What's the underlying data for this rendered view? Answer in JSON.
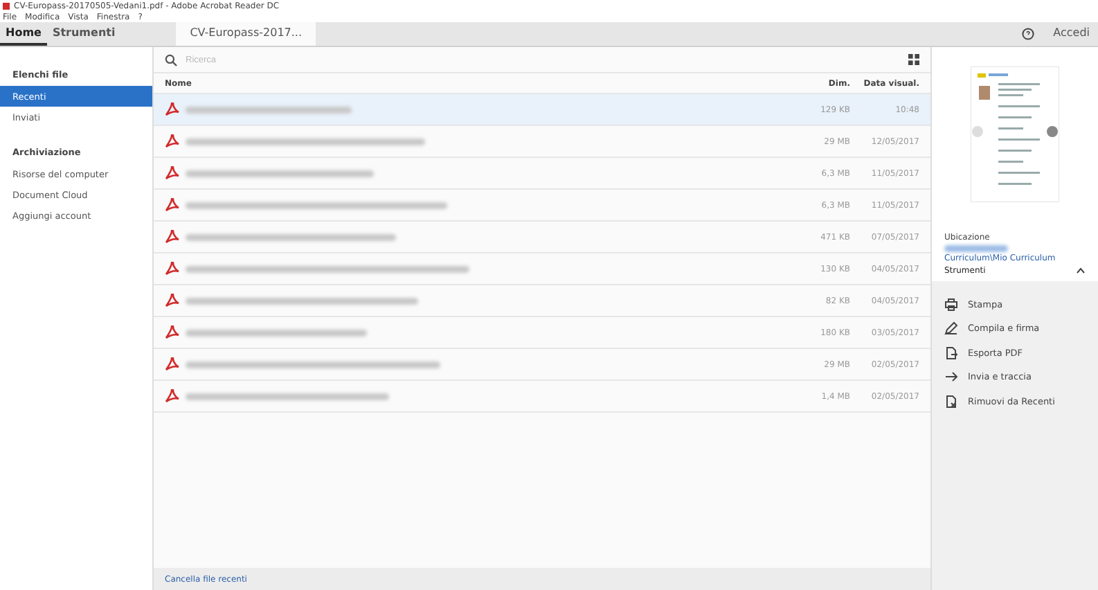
{
  "window": {
    "title": "CV-Europass-20170505-Vedani1.pdf - Adobe Acrobat Reader DC"
  },
  "menu": [
    "File",
    "Modifica",
    "Vista",
    "Finestra",
    "?"
  ],
  "tabs": [
    {
      "label": "Home",
      "selected": true
    },
    {
      "label": "Strumenti",
      "selected": false
    },
    {
      "label": "CV-Europass-2017...",
      "selected": false,
      "kind": "document"
    }
  ],
  "sign_in": "Accedi",
  "sidebar": {
    "sections": [
      {
        "title": "Elenchi file",
        "items": [
          {
            "label": "Recenti",
            "selected": true
          },
          {
            "label": "Inviati",
            "selected": false
          }
        ]
      },
      {
        "title": "Archiviazione",
        "items": [
          {
            "label": "Risorse del computer",
            "selected": false
          },
          {
            "label": "Document Cloud",
            "selected": false
          },
          {
            "label": "Aggiungi account",
            "selected": false
          }
        ]
      }
    ]
  },
  "search": {
    "placeholder": "Ricerca"
  },
  "table": {
    "columns": [
      "Nome",
      "Dim.",
      "Data visual."
    ],
    "rows": [
      {
        "size": "129 KB",
        "date": "10:48",
        "selected": true
      },
      {
        "size": "29 MB",
        "date": "12/05/2017",
        "selected": false
      },
      {
        "size": "6,3 MB",
        "date": "11/05/2017",
        "selected": false
      },
      {
        "size": "6,3 MB",
        "date": "11/05/2017",
        "selected": false
      },
      {
        "size": "471 KB",
        "date": "07/05/2017",
        "selected": false
      },
      {
        "size": "130 KB",
        "date": "04/05/2017",
        "selected": false
      },
      {
        "size": "82 KB",
        "date": "04/05/2017",
        "selected": false
      },
      {
        "size": "180 KB",
        "date": "03/05/2017",
        "selected": false
      },
      {
        "size": "29 MB",
        "date": "02/05/2017",
        "selected": false
      },
      {
        "size": "1,4 MB",
        "date": "02/05/2017",
        "selected": false
      }
    ]
  },
  "footer_link": "Cancella file recenti",
  "details": {
    "location_label": "Ubicazione",
    "location": "Curriculum\\Mio Curriculum",
    "tools_title": "Strumenti",
    "expanded": true,
    "actions": [
      {
        "label": "Stampa",
        "kind": "print"
      },
      {
        "label": "Compila e firma",
        "kind": "sign"
      },
      {
        "label": "Esporta PDF",
        "kind": "export"
      },
      {
        "label": "Invia e traccia",
        "kind": "send"
      },
      {
        "label": "Rimuovi da Recenti",
        "kind": "remove"
      }
    ]
  }
}
